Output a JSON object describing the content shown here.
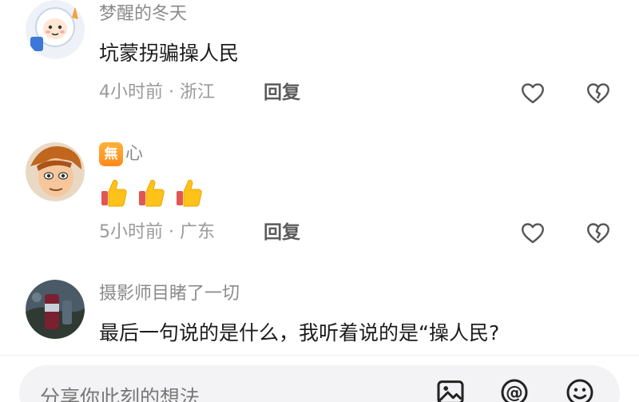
{
  "comments": [
    {
      "username": "梦醒的冬天",
      "text": "坑蒙拐骗操人民",
      "meta": "4小时前 · 浙江",
      "reply_label": "回复"
    },
    {
      "badge": "無",
      "username": "心",
      "emoji_count": 3,
      "meta": "5小时前 · 广东",
      "reply_label": "回复"
    },
    {
      "username": "摄影师目睹了一切",
      "text": "最后一句说的是什么，我听着说的是“操人民?"
    }
  ],
  "composer": {
    "placeholder": "分享你此刻的想法",
    "icons": [
      "image-icon",
      "at-icon",
      "emoji-icon"
    ]
  },
  "colors": {
    "meta": "#9a9a9a",
    "username": "#8a8a8a",
    "text": "#1c1c1c",
    "badge": "#ff9a2a",
    "thumb": "#ffc21a"
  }
}
